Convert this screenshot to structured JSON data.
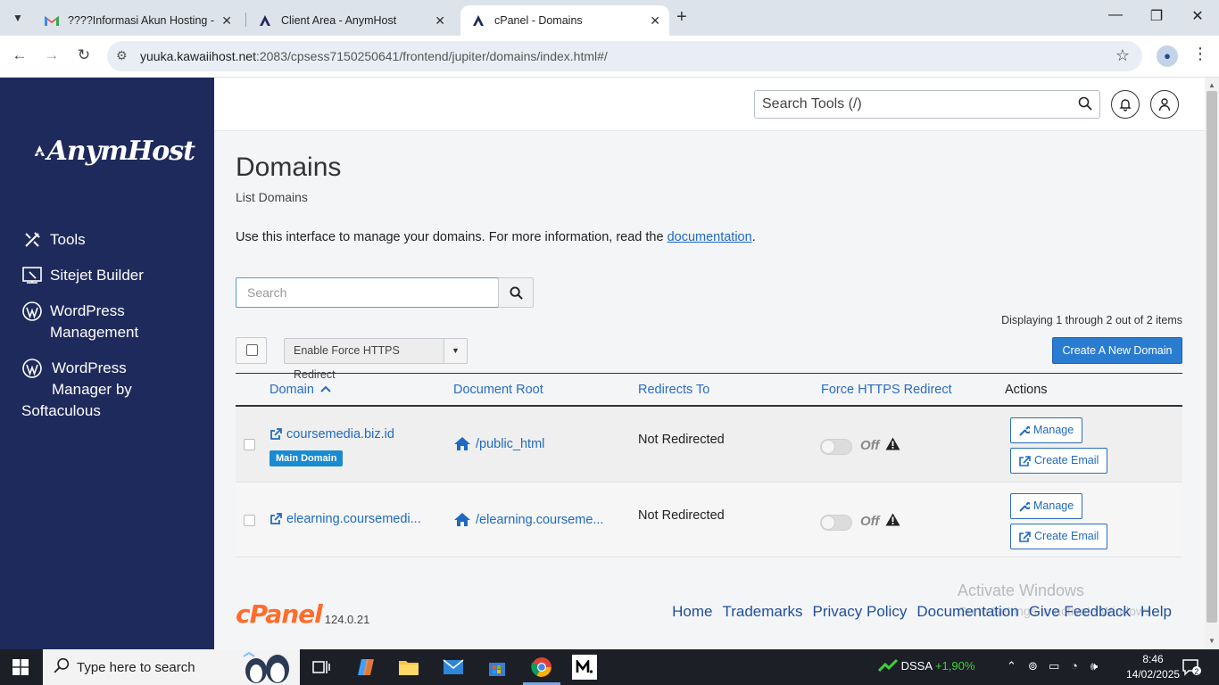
{
  "browser": {
    "tabs": [
      {
        "title": "????Informasi Akun Hosting - c",
        "icon": "gmail-icon",
        "active": false
      },
      {
        "title": "Client Area - AnymHost",
        "icon": "anymhost-icon",
        "active": false
      },
      {
        "title": "cPanel - Domains",
        "icon": "cpanel-icon",
        "active": true
      }
    ],
    "url_host": "yuuka.kawaiihost.net",
    "url_rest": ":2083/cpsess7150250641/frontend/jupiter/domains/index.html#/"
  },
  "sidebar": {
    "logo_text": "AnymHost",
    "items": [
      {
        "label": "Tools",
        "icon": "tools-icon"
      },
      {
        "label": "Sitejet Builder",
        "icon": "sitejet-icon"
      },
      {
        "label": "WordPress Management",
        "line1": "WordPress",
        "line2": "Management",
        "icon": "wordpress-icon"
      },
      {
        "label": "WordPress Manager by Softaculous",
        "line1": "WordPress",
        "line2": "Manager by",
        "line3": "Softaculous",
        "icon": "wordpress-icon"
      }
    ]
  },
  "header": {
    "search_placeholder": "Search Tools (/)"
  },
  "page": {
    "title": "Domains",
    "subtitle": "List Domains",
    "intro_text": "Use this interface to manage your domains. For more information, read the ",
    "intro_link": "documentation",
    "intro_end": ".",
    "search_placeholder": "Search",
    "display_count": "Displaying 1 through 2 out of 2 items",
    "bulk_action_label": "Enable Force HTTPS Redirect",
    "create_button": "Create A New Domain"
  },
  "table": {
    "columns": [
      "Domain",
      "Document Root",
      "Redirects To",
      "Force HTTPS Redirect",
      "Actions"
    ],
    "sort_indicator": "ascending",
    "rows": [
      {
        "domain": "coursemedia.biz.id",
        "badge": "Main Domain",
        "docroot": "/public_html",
        "redirect": "Not Redirected",
        "https": "Off",
        "manage": "Manage",
        "create_email": "Create Email"
      },
      {
        "domain": "elearning.coursemedi...",
        "badge": "",
        "docroot": "/elearning.courseme...",
        "redirect": "Not Redirected",
        "https": "Off",
        "manage": "Manage",
        "create_email": "Create Email"
      }
    ]
  },
  "footer": {
    "brand": "cPanel",
    "version": "124.0.21",
    "links": [
      "Home",
      "Trademarks",
      "Privacy Policy",
      "Documentation",
      "Give Feedback",
      "Help"
    ],
    "watermark_title": "Activate Windows",
    "watermark_sub": "Go to Settings to activate Windows."
  },
  "taskbar": {
    "search_placeholder": "Type here to search",
    "stock_name": "DSSA",
    "stock_change": "+1,90%",
    "time": "8:46",
    "date": "14/02/2025",
    "notifications": "2"
  },
  "colors": {
    "sidebar_bg": "#1f2a5c",
    "link": "#1f6ac0",
    "primary_button": "#2a7cd1",
    "badge": "#1a8ad1",
    "cpanel_orange": "#ff6c2c"
  }
}
